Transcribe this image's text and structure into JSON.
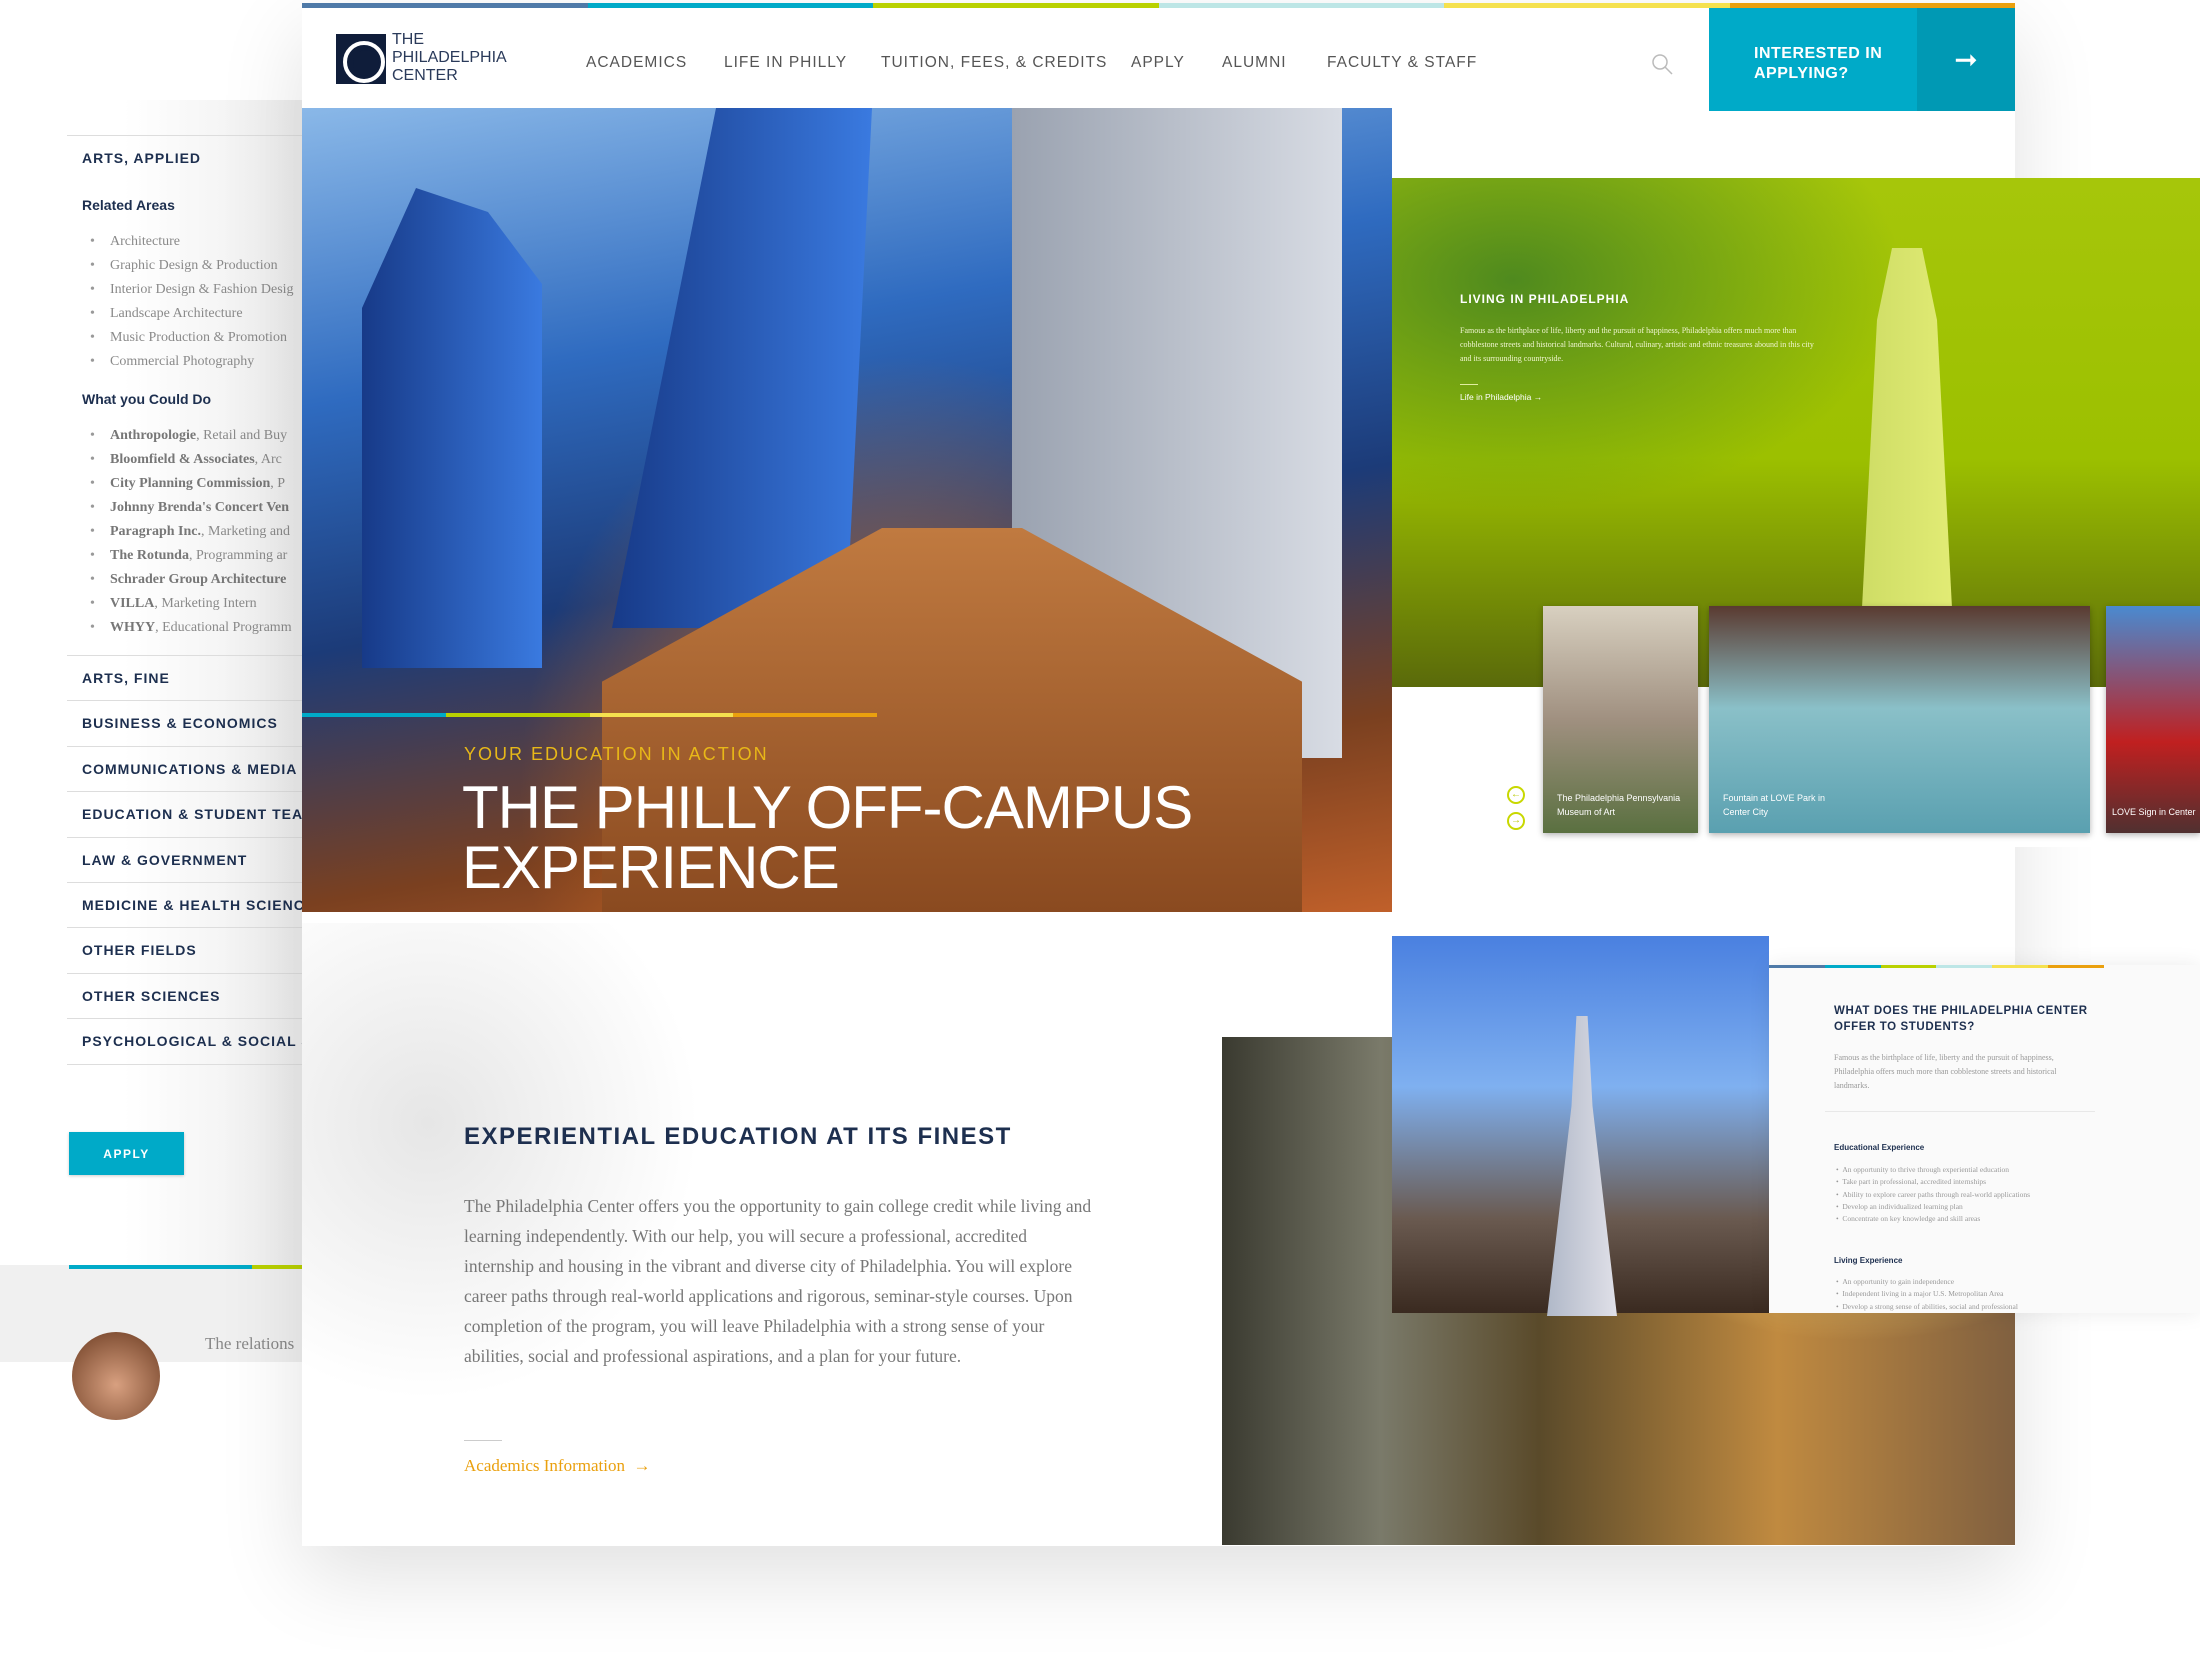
{
  "colors": {
    "accent": "#00aac8",
    "navy": "#1d2f4f",
    "gold": "#eaa00e",
    "lime": "#b9d100",
    "stripe": [
      "#4f7aa8",
      "#00aac8",
      "#b9d100",
      "#bde6e6",
      "#f5e14e",
      "#eaa00e"
    ]
  },
  "header": {
    "logo_lines": [
      "THE",
      "PHILADELPHIA",
      "CENTER"
    ],
    "nav": [
      "ACADEMICS",
      "LIFE IN PHILLY",
      "TUITION, FEES, & CREDITS",
      "APPLY",
      "ALUMNI",
      "FACULTY & STAFF"
    ],
    "search_icon": "search-icon",
    "cta_line1": "INTERESTED IN",
    "cta_line2": "APPLYING?",
    "cta_icon": "arrow-right-icon"
  },
  "hero": {
    "kicker": "YOUR EDUCATION IN ACTION",
    "title_line1": "THE PHILLY OFF-CAMPUS",
    "title_line2": "EXPERIENCE"
  },
  "intro": {
    "title": "EXPERIENTIAL EDUCATION AT ITS FINEST",
    "body": "The Philadelphia Center offers you the opportunity to gain college credit while living and learning independently. With our help, you will secure a professional, accredited internship and housing in the vibrant and diverse city of Philadelphia. You will explore career paths through real-world applications and rigorous, seminar-style courses. Upon completion of the program, you will leave Philadelphia with a strong sense of your abilities, social and professional aspirations, and a plan for your future.",
    "link": "Academics Information"
  },
  "sidebar": {
    "open_section": "ARTS, APPLIED",
    "related_heading": "Related Areas",
    "related": [
      "Architecture",
      "Graphic Design & Production",
      "Interior Design & Fashion Desig",
      "Landscape Architecture",
      "Music Production & Promotion",
      "Commercial Photography"
    ],
    "could_heading": "What you Could Do",
    "could": [
      {
        "org": "Anthropologie",
        "role": ", Retail and Buy"
      },
      {
        "org": "Bloomfield & Associates",
        "role": ", Arc"
      },
      {
        "org": "City Planning Commission",
        "role": ", P"
      },
      {
        "org": "Johnny Brenda's Concert Ven",
        "role": ""
      },
      {
        "org": "Paragraph Inc.",
        "role": ", Marketing and"
      },
      {
        "org": "The Rotunda",
        "role": ", Programming ar"
      },
      {
        "org": "Schrader Group Architecture",
        "role": ""
      },
      {
        "org": "VILLA",
        "role": ", Marketing Intern"
      },
      {
        "org": "WHYY",
        "role": ", Educational Programm"
      }
    ],
    "sections": [
      "ARTS, FINE",
      "BUSINESS & ECONOMICS",
      "COMMUNICATIONS & MEDIA",
      "EDUCATION & STUDENT TEAC",
      "LAW & GOVERNMENT",
      "MEDICINE & HEALTH SCIENCES",
      "OTHER FIELDS",
      "OTHER SCIENCES",
      "PSYCHOLOGICAL & SOCIAL SC"
    ],
    "apply": "APPLY",
    "quote": "The relations"
  },
  "living": {
    "title": "LIVING IN PHILADELPHIA",
    "body": "Famous as the birthplace of life, liberty and the pursuit of happiness, Philadelphia offers much more than cobblestone streets and historical landmarks. Cultural, culinary, artistic and ethnic treasures abound in this city and its surrounding countryside.",
    "link": "Life in Philadelphia",
    "cards": [
      "The Philadelphia Pennsylvania Museum of Art",
      "Fountain at LOVE Park in Center City",
      "LOVE Sign in Center"
    ]
  },
  "offer": {
    "title": "WHAT DOES THE PHILADELPHIA CENTER OFFER TO STUDENTS?",
    "body": "Famous as the birthplace of life, liberty and the pursuit of happiness, Philadelphia offers much more than cobblestone streets and historical landmarks.",
    "edu_heading": "Educational Experience",
    "edu": [
      "An opportunity to thrive through experiential education",
      "Take part in professional, accredited internships",
      "Ability to explore career paths through real-world applications",
      "Develop an individualized learning plan",
      "Concentrate on key knowledge and skill areas"
    ],
    "living_heading": "Living Experience",
    "living": [
      "An opportunity to gain independence",
      "Independent living in a major U.S. Metropolitan Area",
      "Develop a strong sense of abilities, social and professional"
    ]
  }
}
